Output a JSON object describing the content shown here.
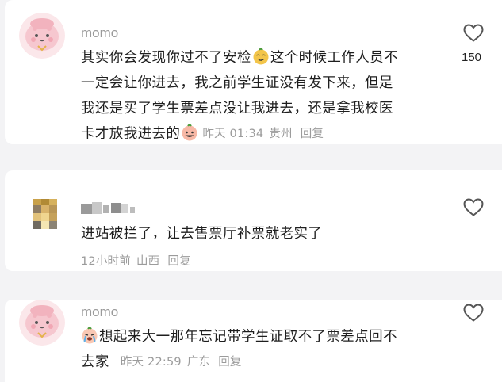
{
  "comments": [
    {
      "username": "momo",
      "avatar_icon": "pink-blob-avatar-icon",
      "text_lines": [
        "其实你会发现你过不了安检",
        "这个时候工作人员不",
        "一定会让你进去，我之前学生证没有发下来，但是",
        "我还是买了学生票差点没让我进去，还是拿我校医",
        "卡才放我进去的"
      ],
      "inline_emojis": [
        "smug-face-emoji-icon",
        "awkward-smile-emoji-icon"
      ],
      "time": "昨天 01:34",
      "location": "贵州",
      "reply_label": "回复",
      "likes": "150"
    },
    {
      "username": "",
      "avatar_icon": "blurred-avatar-icon",
      "text_lines": [
        "进站被拦了，让去售票厅补票就老实了"
      ],
      "time": "12小时前",
      "location": "山西",
      "reply_label": "回复",
      "likes": ""
    },
    {
      "username": "momo",
      "avatar_icon": "pink-blob-avatar-icon",
      "text_lines": [
        "想起来大一那年忘记带学生证取不了票差点回不",
        "去家"
      ],
      "inline_emojis": [
        "crying-face-emoji-icon"
      ],
      "time": "昨天 22:59",
      "location": "广东",
      "reply_label": "回复",
      "likes": ""
    }
  ],
  "colors": {
    "page_background": "#f3f3f5",
    "card_background": "#ffffff",
    "text_primary": "#1e1e1e",
    "text_secondary": "#9b9b9b"
  }
}
